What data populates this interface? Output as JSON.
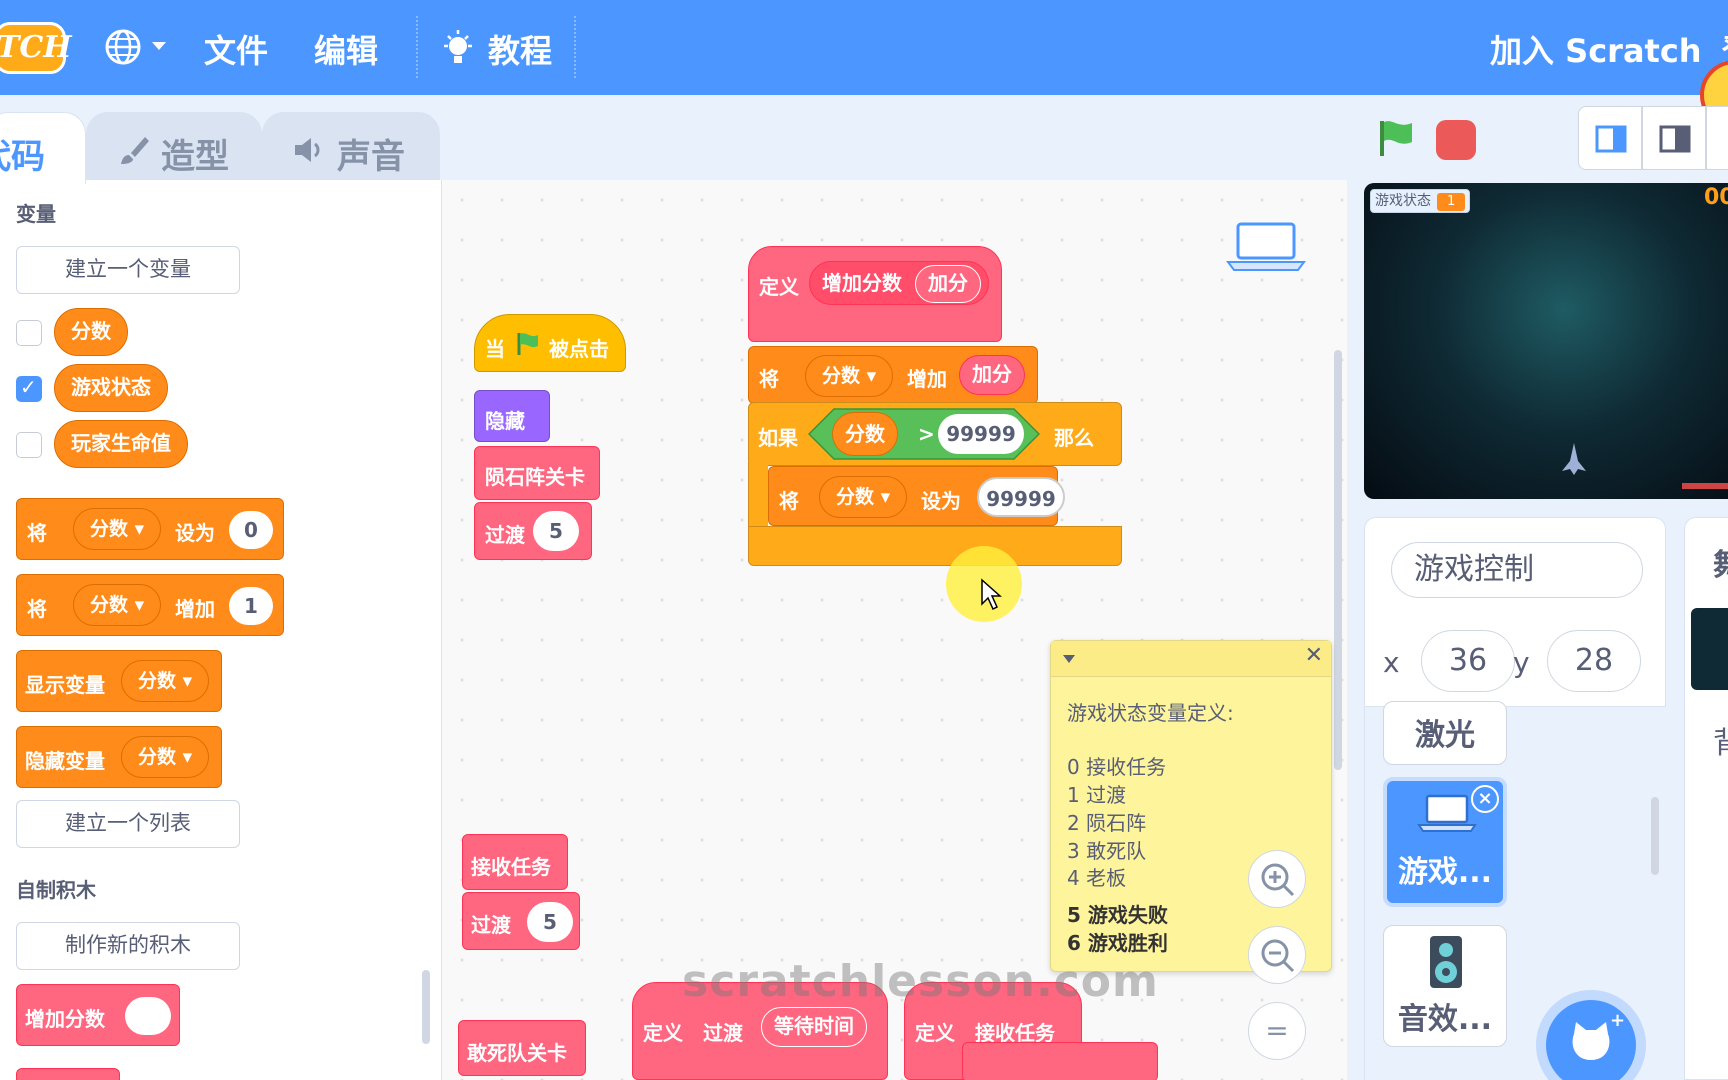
{
  "menu": {
    "logo": "TCH",
    "file": "文件",
    "edit": "编辑",
    "tutorials": "教程",
    "join": "加入 Scratch",
    "edge_char": "登"
  },
  "tabs": {
    "code": "代码",
    "costumes": "造型",
    "sounds": "声音"
  },
  "palette": {
    "variables_title": "变量",
    "make_variable": "建立一个变量",
    "variables": [
      {
        "name": "分数",
        "checked": false
      },
      {
        "name": "游戏状态",
        "checked": true
      },
      {
        "name": "玩家生命值",
        "checked": false
      }
    ],
    "set_block": {
      "verb": "将",
      "var": "分数",
      "op": "设为",
      "value": "0"
    },
    "change_block": {
      "verb": "将",
      "var": "分数",
      "op": "增加",
      "value": "1"
    },
    "show_block": {
      "label": "显示变量",
      "var": "分数"
    },
    "hide_block": {
      "label": "隐藏变量",
      "var": "分数"
    },
    "make_list": "建立一个列表",
    "my_blocks_title": "自制积木",
    "make_block": "制作新的积木",
    "custom_block": "增加分数"
  },
  "scripts": {
    "green_flag_script": {
      "hat": "当",
      "hat_suffix": "被点击",
      "hide": "隐藏",
      "meteor": "陨石阵关卡",
      "transition": "过渡",
      "transition_value": "5"
    },
    "define_script": {
      "define": "定义",
      "proc_name": "增加分数",
      "param": "加分",
      "change_verb": "将",
      "change_var": "分数",
      "change_op": "增加",
      "change_arg": "加分",
      "if_label": "如果",
      "then_label": "那么",
      "cond_var": "分数",
      "cond_op": ">",
      "cond_value": "99999",
      "set_verb": "将",
      "set_var": "分数",
      "set_op": "设为",
      "set_value": "99999"
    },
    "receive_script": {
      "receive": "接收任务",
      "transition": "过渡",
      "transition_value": "5"
    },
    "dare_squad": "敢死队关卡",
    "define_transition": {
      "define": "定义",
      "name": "过渡",
      "param": "等待时间"
    },
    "define_receive": {
      "define": "定义",
      "name": "接收任务"
    }
  },
  "comment": {
    "title": "游戏状态变量定义:",
    "lines": [
      "0  接收任务",
      "1  过渡",
      "2  陨石阵",
      "3  敢死队",
      "4  老板"
    ],
    "bold_lines": [
      "5 游戏失败",
      "6 游戏胜利"
    ]
  },
  "stage": {
    "monitor_label": "游戏状态",
    "monitor_value": "1",
    "score_partial": "00"
  },
  "sprite_info": {
    "name": "游戏控制",
    "x_label": "x",
    "x_value": "36",
    "y_label": "y",
    "y_value": "28"
  },
  "sprite_list": {
    "items": [
      {
        "label": "激光",
        "selected": false
      },
      {
        "label": "游戏...",
        "selected": true
      },
      {
        "label": "音效...",
        "selected": false
      }
    ]
  },
  "stage_pane": {
    "title_partial": "舞",
    "backdrop_partial": "背"
  },
  "zoom": {
    "zoom_in": "+",
    "zoom_out": "−",
    "reset": "="
  },
  "watermark": "scratchlesson.com",
  "colors": {
    "menu_blue": "#4c97ff",
    "variables_orange": "#ff8c1a",
    "my_blocks_pink": "#ff6680",
    "events_yellow": "#ffbf00",
    "looks_purple": "#9966ff",
    "operators_green": "#59c059",
    "comment_yellow": "#fef49c"
  }
}
